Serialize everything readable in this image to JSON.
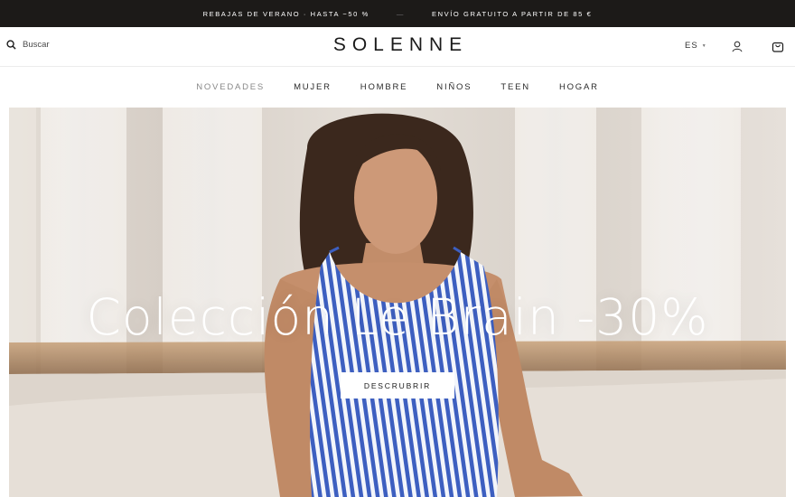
{
  "promo": {
    "left": "REBAJAS DE VERANO · HASTA −50 %",
    "separator": "—",
    "right": "ENVÍO GRATUITO A PARTIR DE 85 €"
  },
  "header": {
    "brand": "SOLENNE",
    "search_label": "Buscar",
    "lang": "ES",
    "icons": [
      "search-icon",
      "user-icon",
      "cart-icon"
    ]
  },
  "nav": {
    "items": [
      "NOVEDADES",
      "MUJER",
      "HOMBRE",
      "NIÑOS",
      "TEEN",
      "HOGAR"
    ],
    "active": "NOVEDADES"
  },
  "hero": {
    "title": "Colección Le Brain -30%",
    "cta": "DESCRUBRIR"
  },
  "colors": {
    "promo_bg": "#1c1a18",
    "nav_active": "#888888",
    "swimsuit_blue": "#3d5fc0"
  }
}
